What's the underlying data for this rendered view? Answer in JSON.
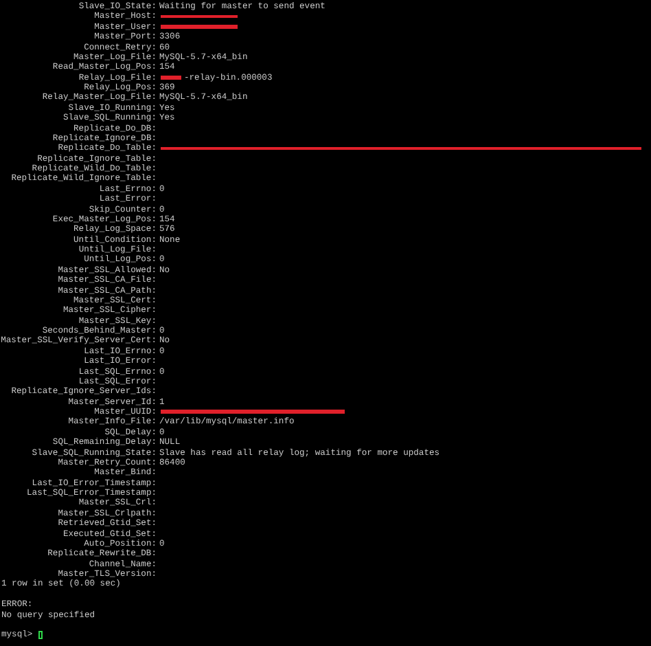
{
  "fields": [
    {
      "label": "Slave_IO_State:",
      "value": "Waiting for master to send event"
    },
    {
      "label": "Master_Host:",
      "kind": "redacted"
    },
    {
      "label": "Master_User:",
      "kind": "redacted"
    },
    {
      "label": "Master_Port:",
      "value": "3306"
    },
    {
      "label": "Connect_Retry:",
      "value": "60"
    },
    {
      "label": "Master_Log_File:",
      "value": "MySQL-5.7-x64_bin"
    },
    {
      "label": "Read_Master_Log_Pos:",
      "value": "154"
    },
    {
      "label": "Relay_Log_File:",
      "kind": "redacted_prefix",
      "value": "-relay-bin.000003"
    },
    {
      "label": "Relay_Log_Pos:",
      "value": "369"
    },
    {
      "label": "Relay_Master_Log_File:",
      "value": "MySQL-5.7-x64_bin"
    },
    {
      "label": "Slave_IO_Running:",
      "value": "Yes"
    },
    {
      "label": "Slave_SQL_Running:",
      "value": "Yes"
    },
    {
      "label": "Replicate_Do_DB:"
    },
    {
      "label": "Replicate_Ignore_DB:"
    },
    {
      "label": "Replicate_Do_Table:",
      "kind": "redacted_full"
    },
    {
      "label": "Replicate_Ignore_Table:"
    },
    {
      "label": "Replicate_Wild_Do_Table:"
    },
    {
      "label": "Replicate_Wild_Ignore_Table:"
    },
    {
      "label": "Last_Errno:",
      "value": "0"
    },
    {
      "label": "Last_Error:"
    },
    {
      "label": "Skip_Counter:",
      "value": "0"
    },
    {
      "label": "Exec_Master_Log_Pos:",
      "value": "154"
    },
    {
      "label": "Relay_Log_Space:",
      "value": "576"
    },
    {
      "label": "Until_Condition:",
      "value": "None"
    },
    {
      "label": "Until_Log_File:"
    },
    {
      "label": "Until_Log_Pos:",
      "value": "0"
    },
    {
      "label": "Master_SSL_Allowed:",
      "value": "No"
    },
    {
      "label": "Master_SSL_CA_File:"
    },
    {
      "label": "Master_SSL_CA_Path:"
    },
    {
      "label": "Master_SSL_Cert:"
    },
    {
      "label": "Master_SSL_Cipher:"
    },
    {
      "label": "Master_SSL_Key:"
    },
    {
      "label": "Seconds_Behind_Master:",
      "value": "0"
    },
    {
      "label": "Master_SSL_Verify_Server_Cert:",
      "value": "No"
    },
    {
      "label": "Last_IO_Errno:",
      "value": "0"
    },
    {
      "label": "Last_IO_Error:"
    },
    {
      "label": "Last_SQL_Errno:",
      "value": "0"
    },
    {
      "label": "Last_SQL_Error:"
    },
    {
      "label": "Replicate_Ignore_Server_Ids:"
    },
    {
      "label": "Master_Server_Id:",
      "value": "1"
    },
    {
      "label": "Master_UUID:",
      "kind": "redacted_wide"
    },
    {
      "label": "Master_Info_File:",
      "value": "/var/lib/mysql/master.info"
    },
    {
      "label": "SQL_Delay:",
      "value": "0"
    },
    {
      "label": "SQL_Remaining_Delay:",
      "value": "NULL"
    },
    {
      "label": "Slave_SQL_Running_State:",
      "value": "Slave has read all relay log; waiting for more updates"
    },
    {
      "label": "Master_Retry_Count:",
      "value": "86400"
    },
    {
      "label": "Master_Bind:"
    },
    {
      "label": "Last_IO_Error_Timestamp:"
    },
    {
      "label": "Last_SQL_Error_Timestamp:"
    },
    {
      "label": "Master_SSL_Crl:"
    },
    {
      "label": "Master_SSL_Crlpath:"
    },
    {
      "label": "Retrieved_Gtid_Set:"
    },
    {
      "label": "Executed_Gtid_Set:"
    },
    {
      "label": "Auto_Position:",
      "value": "0"
    },
    {
      "label": "Replicate_Rewrite_DB:"
    },
    {
      "label": "Channel_Name:"
    },
    {
      "label": "Master_TLS_Version:"
    }
  ],
  "result": "1 row in set (0.00 sec)",
  "error": [
    "ERROR:",
    "No query specified"
  ],
  "prompt": "mysql>"
}
